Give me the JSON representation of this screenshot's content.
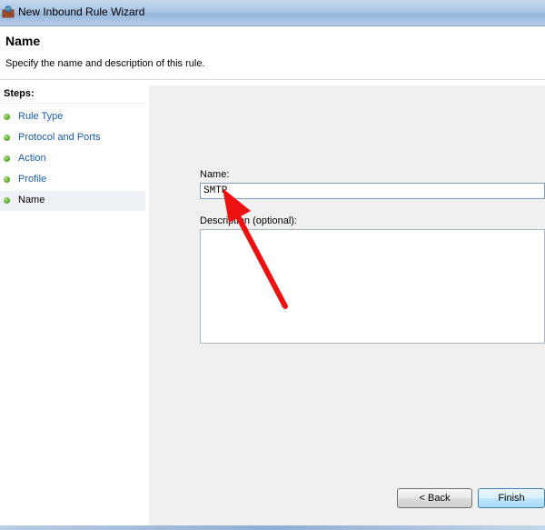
{
  "window": {
    "title": "New Inbound Rule Wizard"
  },
  "header": {
    "title": "Name",
    "subtitle": "Specify the name and description of this rule."
  },
  "steps": {
    "title": "Steps:",
    "items": [
      {
        "label": "Rule Type",
        "current": false
      },
      {
        "label": "Protocol and Ports",
        "current": false
      },
      {
        "label": "Action",
        "current": false
      },
      {
        "label": "Profile",
        "current": false
      },
      {
        "label": "Name",
        "current": true
      }
    ]
  },
  "form": {
    "name_label": "Name:",
    "name_value": "SMTP",
    "description_label": "Description (optional):",
    "description_value": ""
  },
  "buttons": {
    "back_label": "< Back",
    "finish_label": "Finish"
  },
  "colors": {
    "step_link": "#1a5bab",
    "step_dot": "#62b02e",
    "content_bg": "#f0f0f0",
    "annotation_arrow": "#ee1111"
  },
  "icons": {
    "window_icon": "firewall-icon",
    "step_bullet": "green-dot-icon",
    "annotation": "red-arrow-icon"
  }
}
